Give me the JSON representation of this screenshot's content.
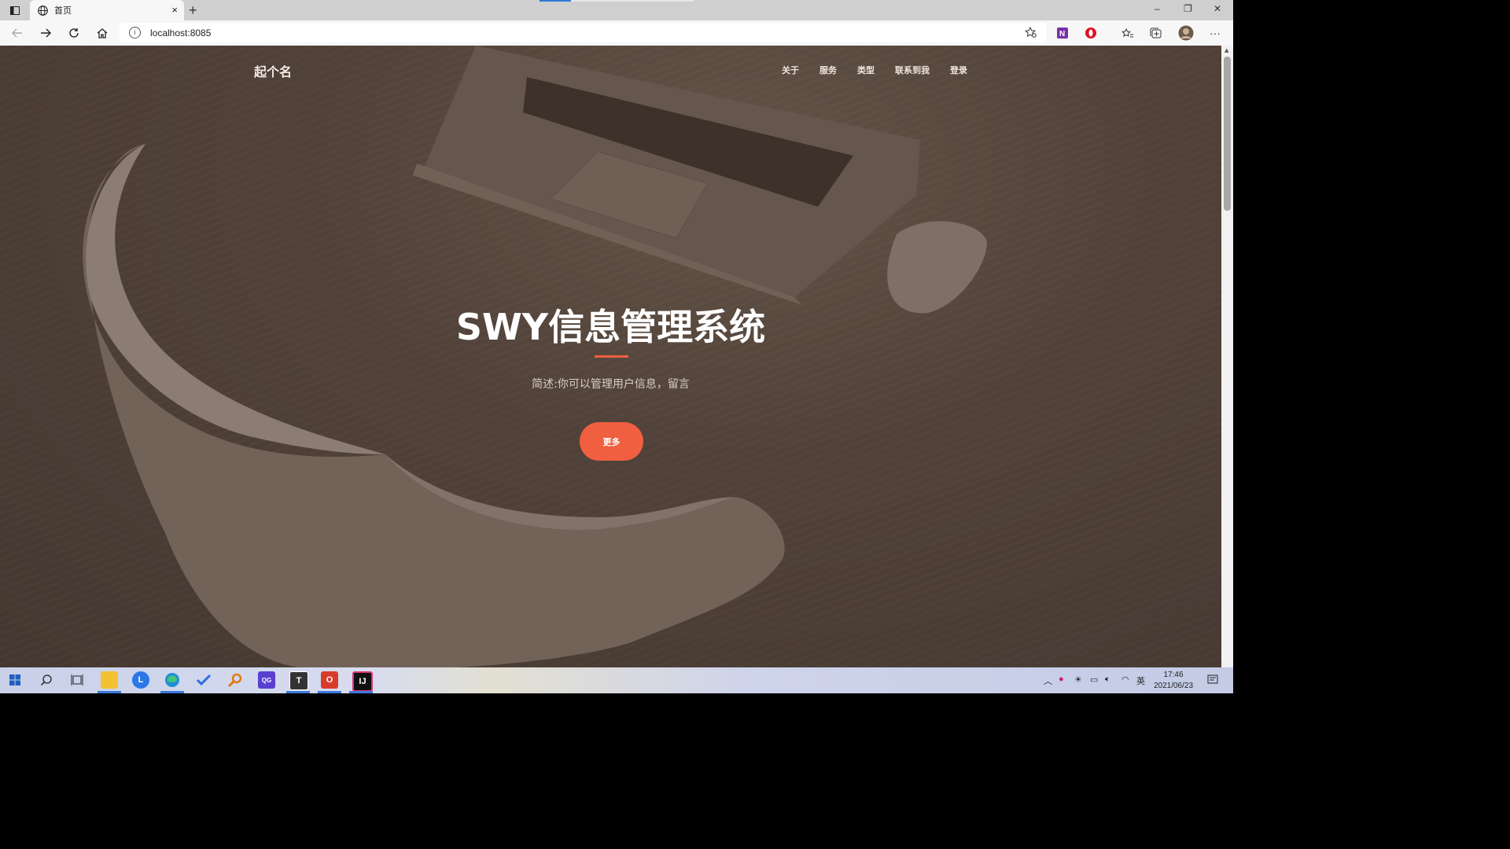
{
  "browser": {
    "tab_title": "首页",
    "url": "localhost:8085",
    "new_tab_symbol": "+",
    "close_tab_symbol": "×",
    "window_controls": [
      "–",
      "❐",
      "✕"
    ],
    "menu_symbol": "···"
  },
  "site": {
    "brand": "起个名",
    "nav": [
      "关于",
      "服务",
      "类型",
      "联系到我",
      "登录"
    ],
    "hero_title": "SWY信息管理系统",
    "hero_subtitle": "简述:你可以管理用户信息，留言",
    "more_button": "更多",
    "accent_color": "#f05f40"
  },
  "taskbar": {
    "time": "17:46",
    "date": "2021/06/23",
    "ime": "英",
    "apps": [
      "start-icon",
      "search-icon",
      "task-view-icon",
      "file-explorer-icon",
      "l-app-icon",
      "edge-icon",
      "todo-icon",
      "search-tool-icon",
      "qq-app-icon",
      "typora-icon",
      "office-icon",
      "intellij-icon"
    ]
  }
}
